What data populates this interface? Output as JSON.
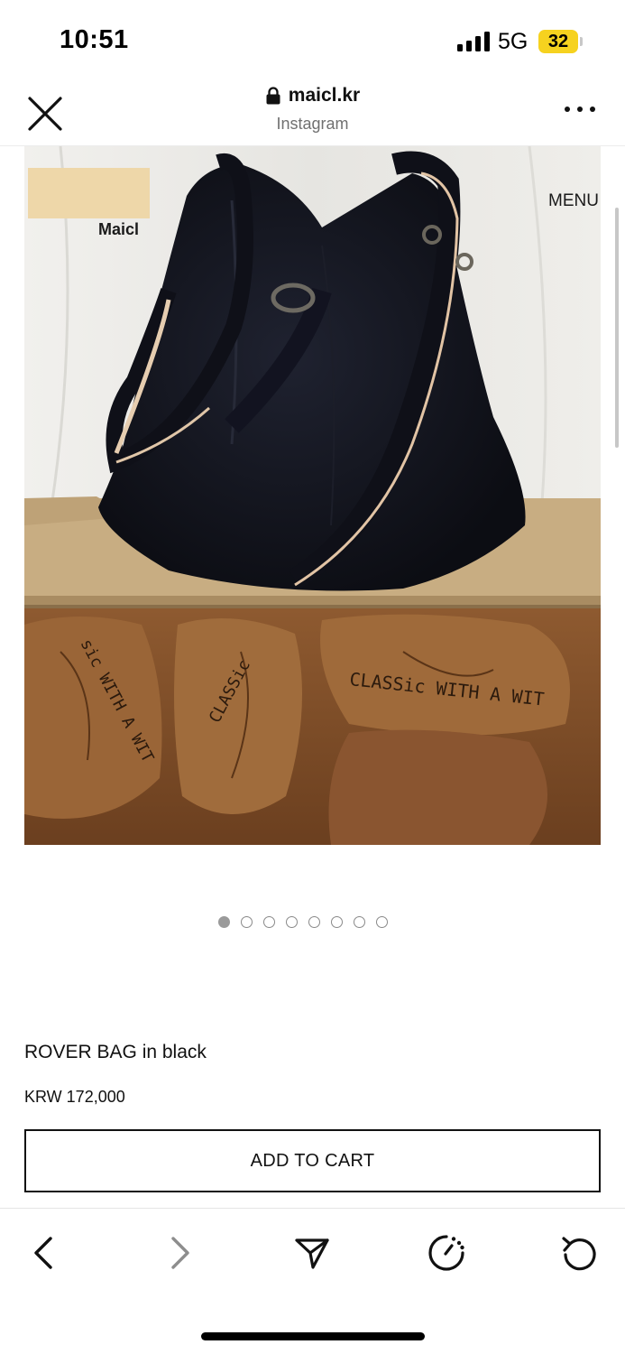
{
  "status_bar": {
    "time": "10:51",
    "network": "5G",
    "battery": "32",
    "battery_color": "#f6d21f",
    "icons": [
      "signal-icon",
      "battery-icon"
    ]
  },
  "browser": {
    "domain": "maicl.kr",
    "source": "Instagram",
    "icons": [
      "close-icon",
      "lock-icon",
      "more-icon"
    ]
  },
  "product_image": {
    "brand": "Maicl",
    "menu": "MENU",
    "wrap_text_1": "CLASSic WITH A WIT",
    "wrap_text_2": "sic WITH A WIT",
    "wrap_text_3": "CLASSic",
    "icon": "product-photo-black-tote-bag"
  },
  "carousel": {
    "total": 8,
    "current": 1
  },
  "product": {
    "title": "ROVER BAG in black",
    "price": "KRW 172,000",
    "add_to_cart": "ADD TO CART"
  },
  "toolbar": {
    "icons": [
      "back-icon",
      "forward-icon",
      "share-icon",
      "speed-icon",
      "reload-icon"
    ]
  }
}
